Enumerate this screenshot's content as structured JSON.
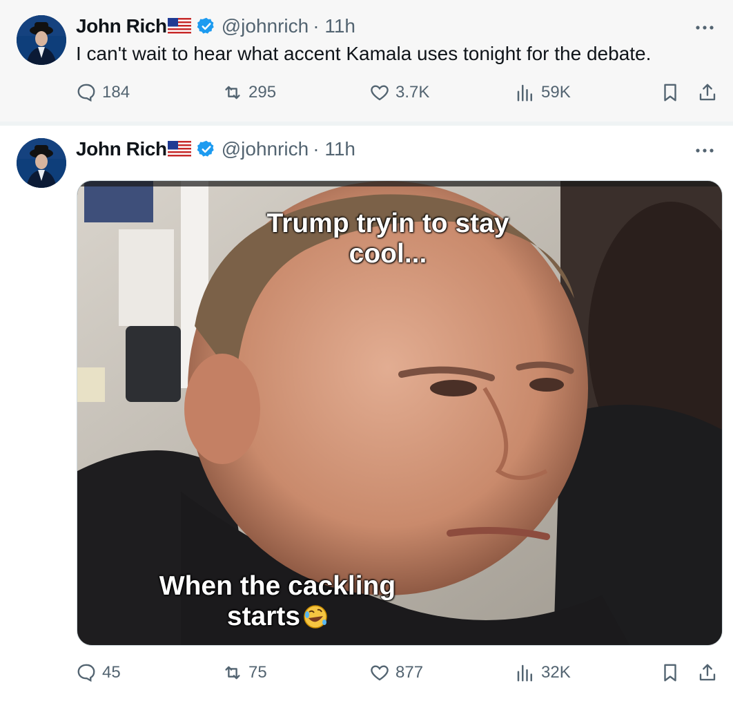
{
  "colors": {
    "blue": "#1d9bf0",
    "gray": "#536471",
    "text": "#0f1419"
  },
  "tweets": [
    {
      "author": {
        "name": "John Rich",
        "handle": "@johnrich",
        "time": "· 11h"
      },
      "text": "I can't wait to hear what accent Kamala uses tonight for the debate.",
      "stats": {
        "replies": "184",
        "reposts": "295",
        "likes": "3.7K",
        "views": "59K"
      }
    },
    {
      "author": {
        "name": "John Rich",
        "handle": "@johnrich",
        "time": "· 11h"
      },
      "image": {
        "top_text": "Trump tryin to stay cool...",
        "bottom_text": "When the cackling starts",
        "emoji": "rolling-on-floor-laughing"
      },
      "stats": {
        "replies": "45",
        "reposts": "75",
        "likes": "877",
        "views": "32K"
      }
    }
  ],
  "icons": [
    "verified-badge-icon",
    "us-flag-icon",
    "more-icon",
    "reply-icon",
    "repost-icon",
    "like-icon",
    "views-icon",
    "bookmark-icon",
    "share-icon"
  ]
}
